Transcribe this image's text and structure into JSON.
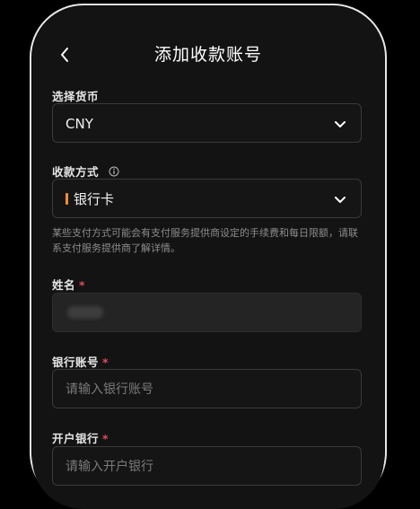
{
  "header": {
    "title": "添加收款账号"
  },
  "currency": {
    "label": "选择货币",
    "value": "CNY"
  },
  "method": {
    "label": "收款方式",
    "value": "银行卡",
    "note": "某些支付方式可能会有支付服务提供商设定的手续费和每日限额，请联系支付服务提供商了解详情。"
  },
  "name_field": {
    "label": "姓名",
    "required": "*"
  },
  "account_field": {
    "label": "银行账号",
    "required": "*",
    "placeholder": "请输入银行账号"
  },
  "bank_field": {
    "label": "开户银行",
    "required": "*",
    "placeholder": "请输入开户银行"
  },
  "colors": {
    "accent_required": "#e04a5a",
    "bank_mark": "#f28c3a"
  }
}
